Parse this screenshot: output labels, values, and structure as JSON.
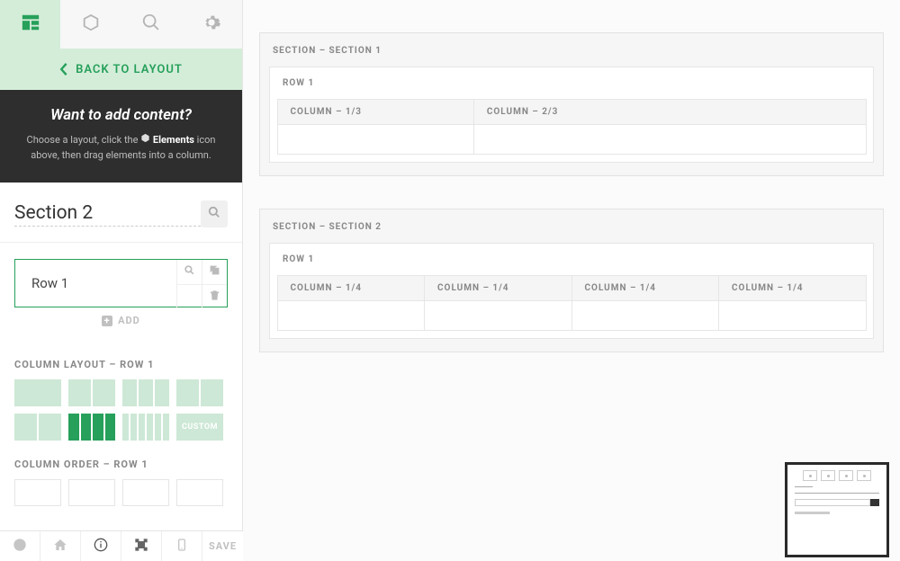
{
  "sidebar": {
    "back_label": "BACK TO LAYOUT",
    "tip": {
      "title": "Want to add content?",
      "line1_a": "Choose a layout, click the ",
      "line1_b": " Elements",
      "line1_c": " icon above, then drag elements into a column."
    },
    "section_title": "Section 2",
    "row_label": "Row 1",
    "add_label": "ADD",
    "column_layout_label": "COLUMN LAYOUT – ROW 1",
    "column_order_label": "COLUMN ORDER – ROW 1",
    "layouts": {
      "custom_label": "CUSTOM"
    }
  },
  "canvas": {
    "sections": [
      {
        "label": "SECTION – SECTION 1",
        "rows": [
          {
            "label": "ROW 1",
            "cols": [
              {
                "label": "COLUMN – 1/3",
                "frac": 1
              },
              {
                "label": "COLUMN – 2/3",
                "frac": 2
              }
            ]
          }
        ]
      },
      {
        "label": "SECTION – SECTION 2",
        "rows": [
          {
            "label": "ROW 1",
            "cols": [
              {
                "label": "COLUMN – 1/4",
                "frac": 1
              },
              {
                "label": "COLUMN – 1/4",
                "frac": 1
              },
              {
                "label": "COLUMN – 1/4",
                "frac": 1
              },
              {
                "label": "COLUMN – 1/4",
                "frac": 1
              }
            ]
          }
        ]
      }
    ]
  },
  "footer": {
    "save_label": "SAVE"
  }
}
